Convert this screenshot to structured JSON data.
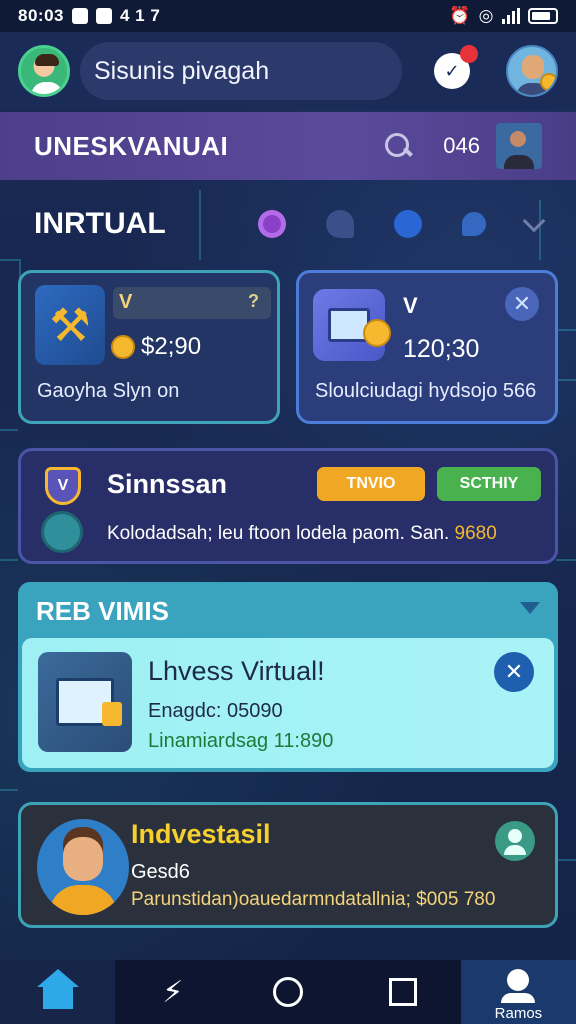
{
  "status_bar": {
    "time": "80:03",
    "carrier": "4 1 7"
  },
  "header": {
    "search_text": "Sisunis pivagah",
    "chat_icon": "chat-bubble-icon"
  },
  "banner": {
    "title": "UNESKVANUAI",
    "count": "046"
  },
  "section": {
    "title": "INRTUAL",
    "icons": [
      "purple-ring-icon",
      "dark-bubble-icon",
      "heart-icon",
      "pin-icon",
      "chevron-down-icon"
    ]
  },
  "cards": [
    {
      "icon": "tool-icon",
      "top_left": "V",
      "top_right": "?",
      "price": "$2;90",
      "caption": "Gaoyha Slyn on"
    },
    {
      "icon": "document-coin-icon",
      "label": "V",
      "value": "120;30",
      "caption": "Sloulciudagi hydsojo 566"
    }
  ],
  "wide_card": {
    "name": "Sinnssan",
    "button_orange": "TNVIO",
    "button_green": "SCTHIY",
    "description": "Kolodadsah; leu ftoon lodela paom. San.",
    "description_value": "9680"
  },
  "panel": {
    "title": "REB VIMIS",
    "item_title": "Lhvess Virtual!",
    "item_line1": "Enagdc: 05090",
    "item_line2": "Linamiardsag 11:890"
  },
  "invest": {
    "title": "Indvestasil",
    "subtitle": "Gesd6",
    "description": "Parunstidan)oauedarmndatallnia; $005 780"
  },
  "nav": {
    "items": [
      "home",
      "lightning",
      "circle",
      "square",
      "profile"
    ],
    "profile_label": "Ramos"
  },
  "colors": {
    "accent_cyan": "#3aa3bd",
    "banner_purple": "#4d3f8a",
    "gold": "#f5b82e"
  }
}
